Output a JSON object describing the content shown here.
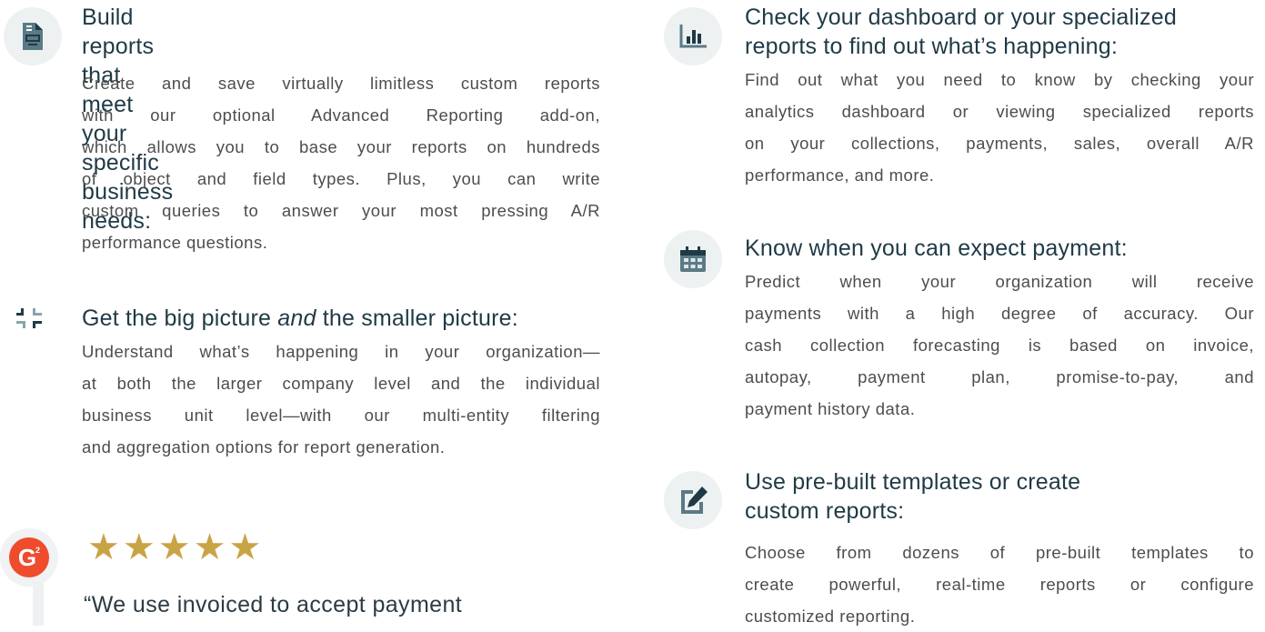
{
  "left_column": {
    "features": [
      {
        "icon": "document-icon",
        "title_lines": [
          "Build reports that meet your specific",
          "business needs:"
        ],
        "body_lines": [
          "Create and save virtually limitless custom reports",
          "with our optional Advanced Reporting add-on,",
          "which allows you to base your reports on hundreds",
          "of object and field types. Plus, you can write",
          "custom queries to answer your most pressing A/R",
          "performance questions."
        ]
      },
      {
        "icon": "compress-arrows-icon",
        "title_before": "Get the big picture ",
        "title_em": "and",
        "title_after": " the smaller picture:",
        "body_lines": [
          "Understand what’s happening in your organization—",
          "at both the larger company level and the individual",
          "business unit level—with our multi-entity filtering",
          "and aggregation options for report generation."
        ]
      }
    ],
    "review": {
      "logo_letter": "G",
      "logo_superscript": "2",
      "star_count": 5,
      "rating": 5,
      "quote": "“We use invoiced to accept payment"
    }
  },
  "right_column": {
    "features": [
      {
        "icon": "bar-chart-icon",
        "title_lines": [
          "Check your dashboard or your specialized",
          "reports to find out what’s happening:"
        ],
        "body_lines": [
          "Find out what you need to know by checking your",
          "analytics dashboard or viewing specialized reports",
          "on your collections, payments, sales, overall A/R",
          "performance, and more."
        ]
      },
      {
        "icon": "calendar-icon",
        "title_lines": [
          "Know when you can expect payment:"
        ],
        "body_lines": [
          "Predict when your organization will receive",
          "payments with a high degree of accuracy. Our",
          "cash collection forecasting is based on invoice,",
          "autopay, payment plan, promise-to-pay, and",
          "payment history data."
        ]
      },
      {
        "icon": "edit-icon",
        "title_lines": [
          "Use pre-built templates or create",
          "custom reports:"
        ],
        "body_lines": [
          "Choose from dozens of pre-built templates to",
          "create powerful, real-time reports or configure",
          "customized reporting."
        ]
      }
    ]
  },
  "colors": {
    "heading": "#1f3a46",
    "body": "#4d4d4d",
    "icon_bg": "#eef1f2",
    "icon_fg": "#5a7a86",
    "icon_dark": "#1f3a46",
    "star": "#c9a445",
    "g2_red": "#ef4b2d"
  }
}
